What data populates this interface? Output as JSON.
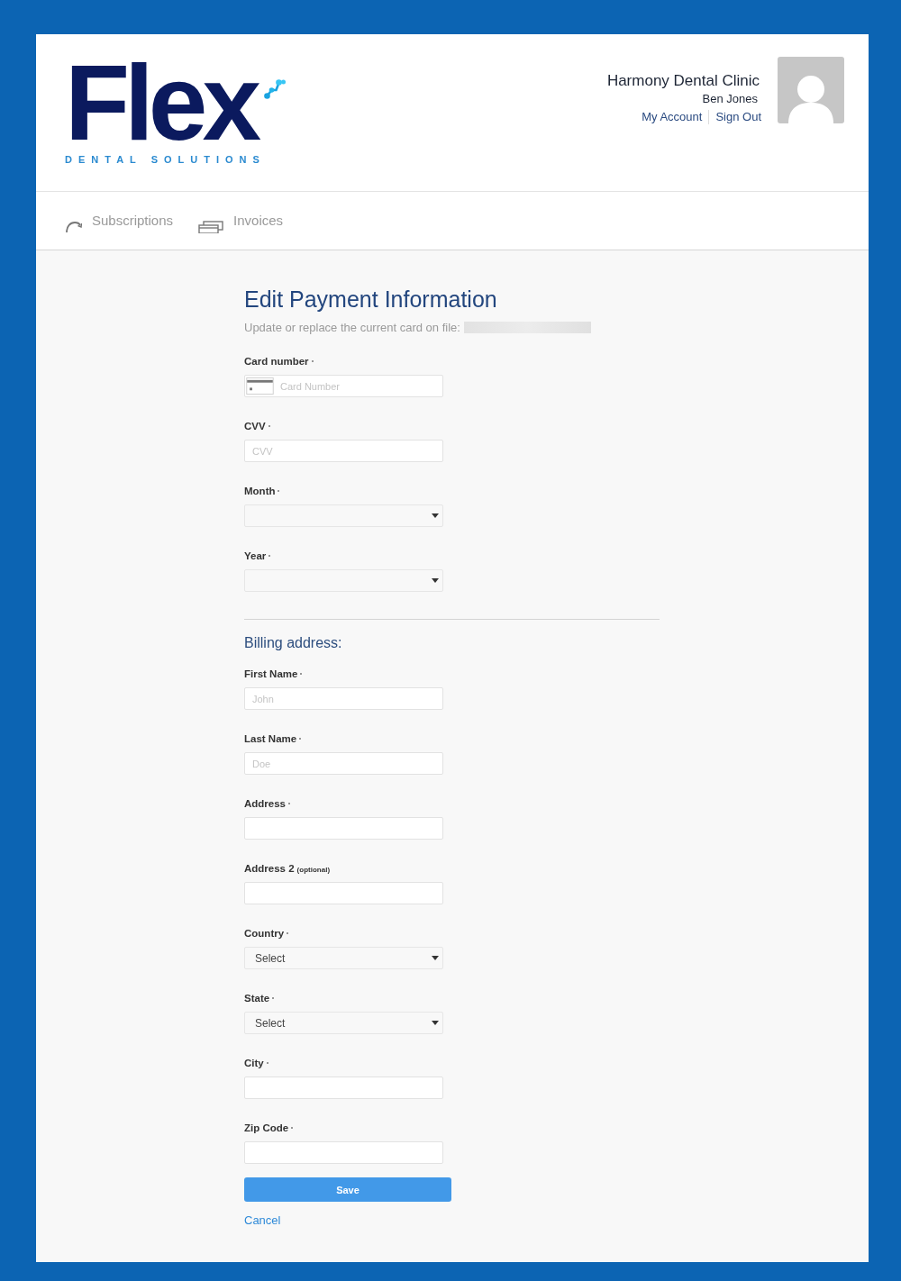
{
  "header": {
    "logo": {
      "wordmark": "Flex",
      "tagline": "DENTAL SOLUTIONS"
    },
    "account": {
      "clinic": "Harmony Dental Clinic",
      "user": "Ben Jones",
      "links": [
        "My Account",
        "Sign Out"
      ]
    }
  },
  "nav": {
    "tabs": [
      {
        "label": "Subscriptions",
        "selected": false
      },
      {
        "label": "Invoices",
        "selected": false
      }
    ]
  },
  "form": {
    "title": "Edit Payment Information",
    "subtitle": "Update or replace the current card on file:",
    "card_fields": [
      {
        "kind": "card",
        "label": "Card number",
        "required": true,
        "placeholder": "Card Number"
      },
      {
        "kind": "text",
        "label": "CVV",
        "required": true,
        "placeholder": "CVV"
      },
      {
        "kind": "select",
        "label": "Month",
        "required": true
      },
      {
        "kind": "select",
        "label": "Year",
        "required": true
      }
    ],
    "billing_title": "Billing address:",
    "billing_fields": [
      {
        "kind": "text",
        "label": "First Name",
        "required": true,
        "placeholder": "John"
      },
      {
        "kind": "text",
        "label": "Last Name",
        "required": true,
        "placeholder": "Doe"
      },
      {
        "kind": "text",
        "label": "Address",
        "required": true
      },
      {
        "kind": "text",
        "label": "Address 2",
        "required": false,
        "note": "(optional)"
      },
      {
        "kind": "select",
        "label": "Country",
        "required": true,
        "value": "Select"
      },
      {
        "kind": "select",
        "label": "State",
        "required": true,
        "value": "Select"
      },
      {
        "kind": "text",
        "label": "City",
        "required": true
      },
      {
        "kind": "text",
        "label": "Zip Code",
        "required": true
      }
    ],
    "save": "Save",
    "cancel": "Cancel"
  }
}
